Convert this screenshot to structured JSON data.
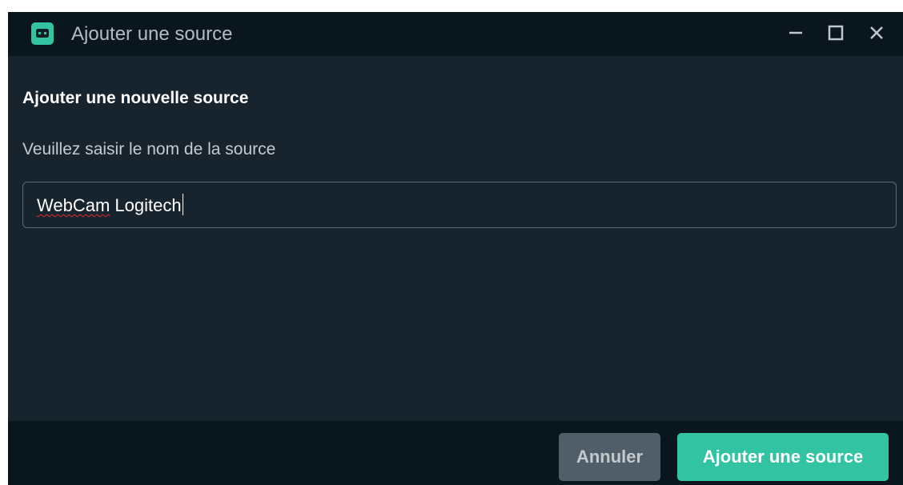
{
  "window": {
    "title": "Ajouter une source",
    "icon": "streamlabs-app-icon"
  },
  "window_controls": {
    "minimize_icon": "minimize-icon",
    "maximize_icon": "maximize-icon",
    "close_icon": "close-icon"
  },
  "dialog": {
    "heading": "Ajouter une nouvelle source",
    "prompt": "Veuillez saisir le nom de la source",
    "source_name": {
      "value_word_1": "WebCam",
      "value_rest": " Logitech"
    }
  },
  "footer": {
    "cancel_label": "Annuler",
    "submit_label": "Ajouter une source"
  },
  "colors": {
    "accent": "#31c3a2",
    "window_bg": "#17242d",
    "titlebar_bg": "#09161d",
    "cancel_bg": "#4f5e68"
  }
}
